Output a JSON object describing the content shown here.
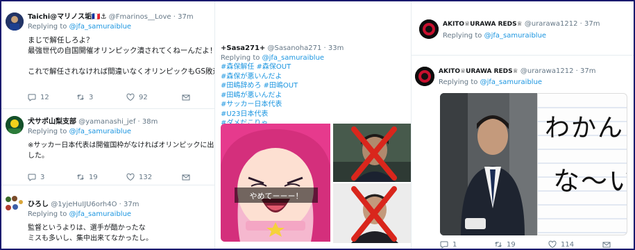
{
  "left": {
    "tweets": [
      {
        "name": "Taichi@マリノス垢🇫🇷⚓",
        "handle": "@Fmarinos__Love",
        "time": "· 37m",
        "replying_label": "Replying to",
        "replying_to": "@jfa_samuraiblue",
        "lines": [
          "まじで解任しろよ？",
          "最強世代の自国開催オリンピック潰されてくねーんだよ！",
          "",
          "これで解任されなければ間違いなくオリンピックもGS敗退でしょうね"
        ],
        "replies": "12",
        "retweets": "3",
        "likes": "92"
      },
      {
        "name": "犬サポ山梨支部",
        "handle": "@yamanashi_jef",
        "time": "· 38m",
        "replying_label": "Replying to",
        "replying_to": "@jfa_samuraiblue",
        "lines": [
          "※サッカー日本代表は開催国枠がなければオリンピックに出られませんで",
          "した。"
        ],
        "replies": "3",
        "retweets": "19",
        "likes": "132"
      },
      {
        "name": "ひろし",
        "handle": "@1yjeHuIJU6orh4O",
        "time": "· 37m",
        "replying_label": "Replying to",
        "replying_to": "@jfa_samuraiblue",
        "lines": [
          "監督というよりは、選手が酷かったな",
          "ミスも多いし、集中出来てなかったし。"
        ]
      }
    ]
  },
  "mid": {
    "name": "+Sasa271+",
    "handle": "@Sasanoha271",
    "time": "· 33m",
    "replying_label": "Replying to",
    "replying_to": "@jfa_samuraiblue",
    "hashtags": [
      "#森保解任 #森保OUT",
      "#森保が悪いんだよ",
      "#田嶋辞めろ #田嶋OUT",
      "#田嶋が悪いんだよ",
      "#サッカー日本代表",
      "#U23日本代表",
      "#ダメだこりゃ"
    ],
    "caption": "やめてーーー！"
  },
  "right": {
    "tweets": [
      {
        "name": "AKITO♕URAWA REDS♕",
        "handle": "@urarawa1212",
        "time": "· 37m",
        "replying_label": "Replying to",
        "replying_to": "@jfa_samuraiblue"
      },
      {
        "name": "AKITO♕URAWA REDS♕",
        "handle": "@urarawa1212",
        "time": "· 37m",
        "replying_label": "Replying to",
        "replying_to": "@jfa_samuraiblue",
        "handwriting": [
          "わかん",
          "な～い"
        ],
        "replies": "1",
        "retweets": "19",
        "likes": "114"
      }
    ]
  },
  "colors": {
    "link": "#1b95e0",
    "muted": "#657786",
    "text": "#14171a",
    "border": "#e6ecf0",
    "frame": "#1a1a6e",
    "cross": "#d9261c"
  }
}
